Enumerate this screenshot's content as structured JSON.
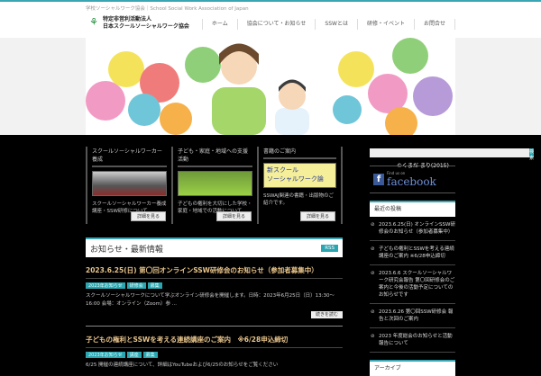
{
  "header": {
    "tagline": "学校ソーシャルワーク協会｜School Social Work Association of Japan",
    "logo_line1": "特定非営利活動法人",
    "logo_line2": "日本スクールソーシャルワーク協会",
    "logo_mark": "SSWAJ",
    "nav": [
      "ホーム",
      "協会について・お知らせ",
      "SSWとは",
      "研修・イベント",
      "お問合せ"
    ]
  },
  "banner": {
    "credit": "©くまだ まり(2015)"
  },
  "cards": [
    {
      "title": "スクールソーシャルワーカー養成",
      "text": "スクールソーシャルワーカー養成講座・SSW研修について",
      "more": "詳細を見る"
    },
    {
      "title": "子ども・家庭・地域への支援活動",
      "text": "子どもの権利を大切にした学校・家庭・地域での活動について",
      "more": "詳細を見る"
    },
    {
      "title": "書籍のご案内",
      "text": "SSWAJ関連の書籍・出版物のご紹介です。",
      "more": "詳細を見る"
    }
  ],
  "news": {
    "title": "お知らせ・最新情報",
    "rss": "RSS",
    "posts": [
      {
        "title": "2023.6.25(日) 第〇回オンラインSSW研修会のお知らせ（参加者募集中）",
        "tags": [
          "2023年お知らせ",
          "研修会",
          "募集"
        ],
        "excerpt": "スクールソーシャルワークについて学ぶオンライン研修会を開催します。日時：2023年6月25日（日）13:30〜16:00 会場：オンライン（Zoom）参 ...",
        "more": "続きを読む"
      },
      {
        "title": "子どもの権利とSSWを考える連続講座のご案内　※6/28申込締切",
        "tags": [
          "2023年お知らせ",
          "講座",
          "募集"
        ],
        "excerpt": "6/25 開催の連続講座について、詳細はYouTubeおよび6/25のお知らせをご覧ください"
      }
    ]
  },
  "sidebar": {
    "search_button": "検索",
    "facebook_small": "Find us on",
    "facebook": "facebook",
    "recent_title": "最近の投稿",
    "recent": [
      "2023.6.25(日) オンラインSSW研修会のお知らせ（参加者募集中）",
      "子どもの権利とSSWを考える連続講座のご案内 ※6/28申込締切",
      "2023.6.6 スクールソーシャルワーク研究会報告 第〇回研修会のご案内と今後の活動予定についてのお知らせです",
      "2023.6.26 第〇回SSW研修会 報告と次回のご案内",
      "2023 年度総会のお知らせと活動報告について"
    ],
    "archive_title": "アーカイブ"
  }
}
